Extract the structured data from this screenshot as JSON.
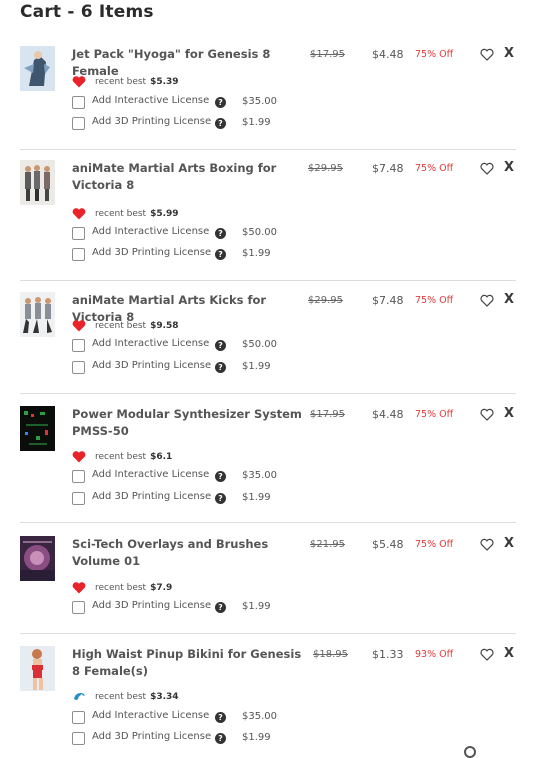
{
  "cart": {
    "title": "Cart - 6 Items"
  },
  "items": [
    {
      "name": "Jet Pack \"Hyoga\" for Genesis 8 Female",
      "old_price": "$17.95",
      "new_price": "$4.48",
      "discount": "75% Off",
      "recent_label": "recent best",
      "recent_price": "$5.39",
      "recent_icon": "heart-icon",
      "thumb_icon": "jetpack-figure-thumbnail",
      "licenses": [
        {
          "label": "Add Interactive License",
          "price": "$35.00"
        },
        {
          "label": "Add 3D Printing License",
          "price": "$1.99"
        }
      ]
    },
    {
      "name": "aniMate Martial Arts Boxing for Victoria 8",
      "old_price": "$29.95",
      "new_price": "$7.48",
      "discount": "75% Off",
      "recent_label": "recent best",
      "recent_price": "$5.99",
      "recent_icon": "heart-icon",
      "thumb_icon": "boxing-figures-thumbnail",
      "licenses": [
        {
          "label": "Add Interactive License",
          "price": "$50.00"
        },
        {
          "label": "Add 3D Printing License",
          "price": "$1.99"
        }
      ]
    },
    {
      "name": "aniMate Martial Arts Kicks for Victoria 8",
      "old_price": "$29.95",
      "new_price": "$7.48",
      "discount": "75% Off",
      "recent_label": "recent best",
      "recent_price": "$9.58",
      "recent_icon": "heart-icon",
      "thumb_icon": "kicks-figures-thumbnail",
      "licenses": [
        {
          "label": "Add Interactive License",
          "price": "$50.00"
        },
        {
          "label": "Add 3D Printing License",
          "price": "$1.99"
        }
      ]
    },
    {
      "name": "Power Modular Synthesizer System PMSS-50",
      "old_price": "$17.95",
      "new_price": "$4.48",
      "discount": "75% Off",
      "recent_label": "recent best",
      "recent_price": "$6.1",
      "recent_icon": "heart-icon",
      "thumb_icon": "synthesizer-thumbnail",
      "licenses": [
        {
          "label": "Add Interactive License",
          "price": "$35.00"
        },
        {
          "label": "Add 3D Printing License",
          "price": "$1.99"
        }
      ]
    },
    {
      "name": "Sci-Tech Overlays and Brushes Volume 01",
      "old_price": "$21.95",
      "new_price": "$5.48",
      "discount": "75% Off",
      "recent_label": "recent best",
      "recent_price": "$7.9",
      "recent_icon": "heart-icon",
      "thumb_icon": "scitech-overlays-thumbnail",
      "licenses": [
        {
          "label": "Add 3D Printing License",
          "price": "$1.99"
        }
      ]
    },
    {
      "name": "High Waist Pinup Bikini for Genesis 8 Female(s)",
      "old_price": "$18.95",
      "new_price": "$1.33",
      "discount": "93% Off",
      "recent_label": "recent best",
      "recent_price": "$3.34",
      "recent_icon": "dolphin-icon",
      "thumb_icon": "bikini-figure-thumbnail",
      "licenses": [
        {
          "label": "Add Interactive License",
          "price": "$35.00"
        },
        {
          "label": "Add 3D Printing License",
          "price": "$1.99"
        }
      ]
    }
  ],
  "icons": {
    "wishlist": "heart-outline-icon",
    "remove": "X",
    "help": "?"
  },
  "colors": {
    "discount": "#e03a3a",
    "heart": "#e8232a",
    "dolphin": "#2a8fc7",
    "divider": "#dcdcdc"
  }
}
